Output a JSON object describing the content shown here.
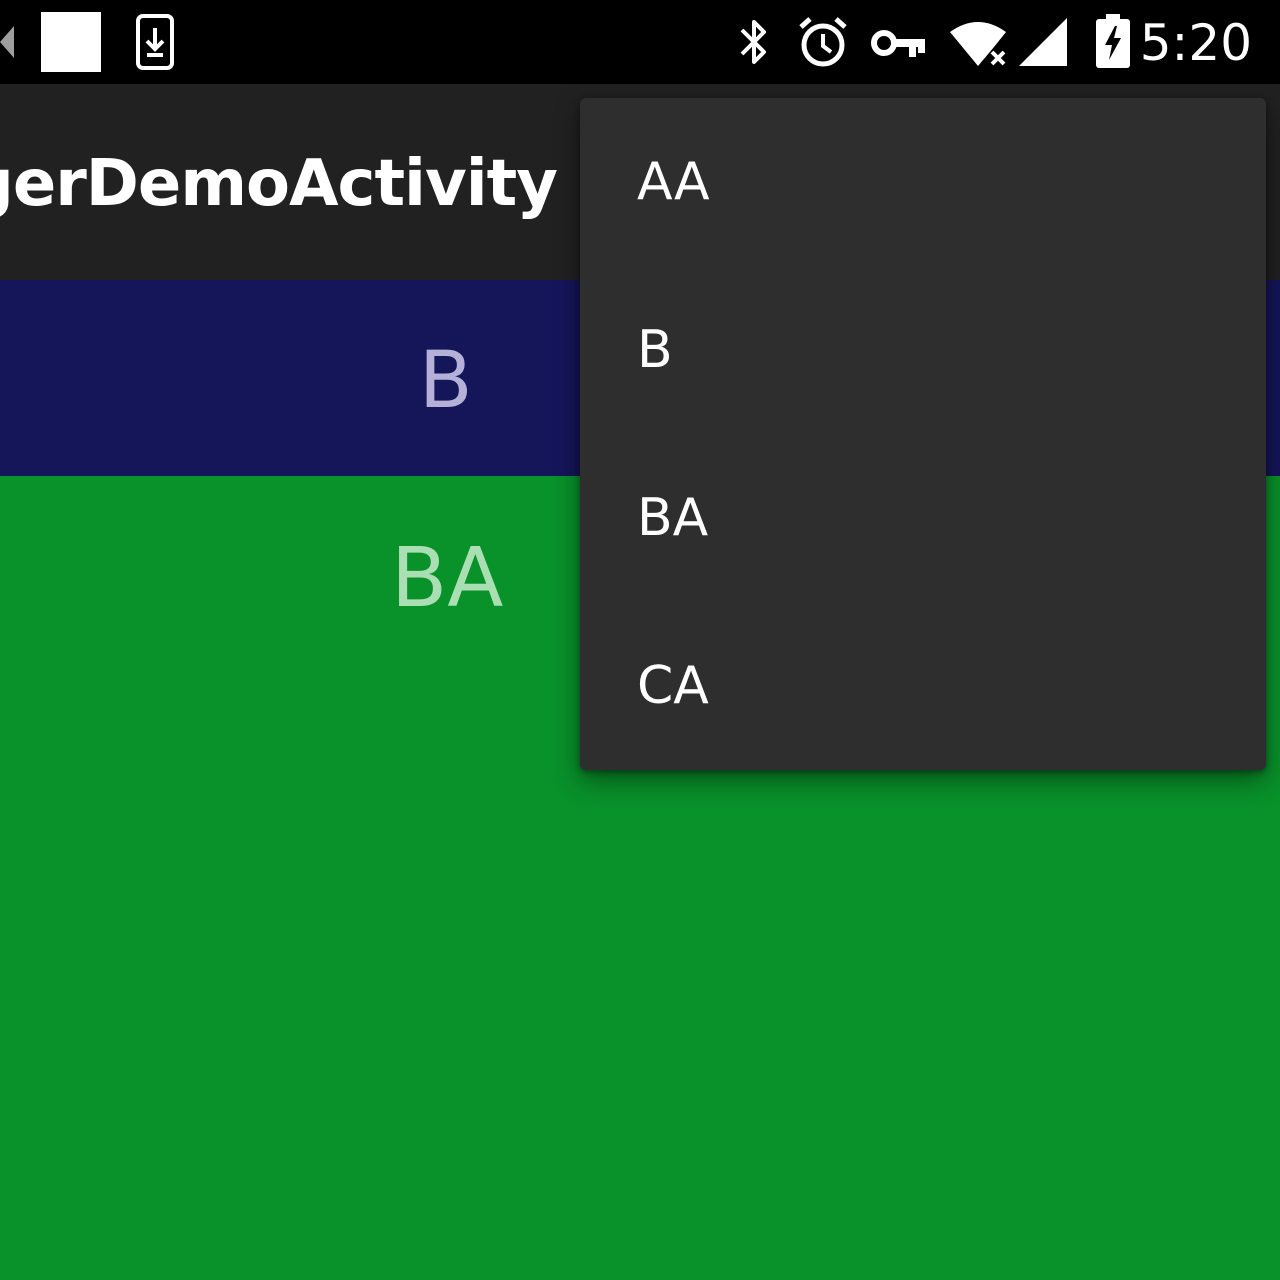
{
  "status_bar": {
    "time": "5:20",
    "left_icons": [
      "media-icon",
      "notification-square-icon",
      "download-icon"
    ],
    "right_icons": [
      "bluetooth-icon",
      "alarm-icon",
      "vpn-key-icon",
      "wifi-no-internet-icon",
      "cell-signal-icon",
      "battery-charging-icon"
    ]
  },
  "app_bar": {
    "title": "gerDemoActivity"
  },
  "pages": {
    "current_tab_label": "B",
    "page_content_label": "BA"
  },
  "overflow_menu": {
    "items": [
      "AA",
      "B",
      "BA",
      "CA"
    ]
  },
  "colors": {
    "status_bar": "#000000",
    "app_bar": "#212121",
    "tab_strip": "#15155a",
    "page_background": "#09912a",
    "menu_background": "#2e2e2e"
  }
}
